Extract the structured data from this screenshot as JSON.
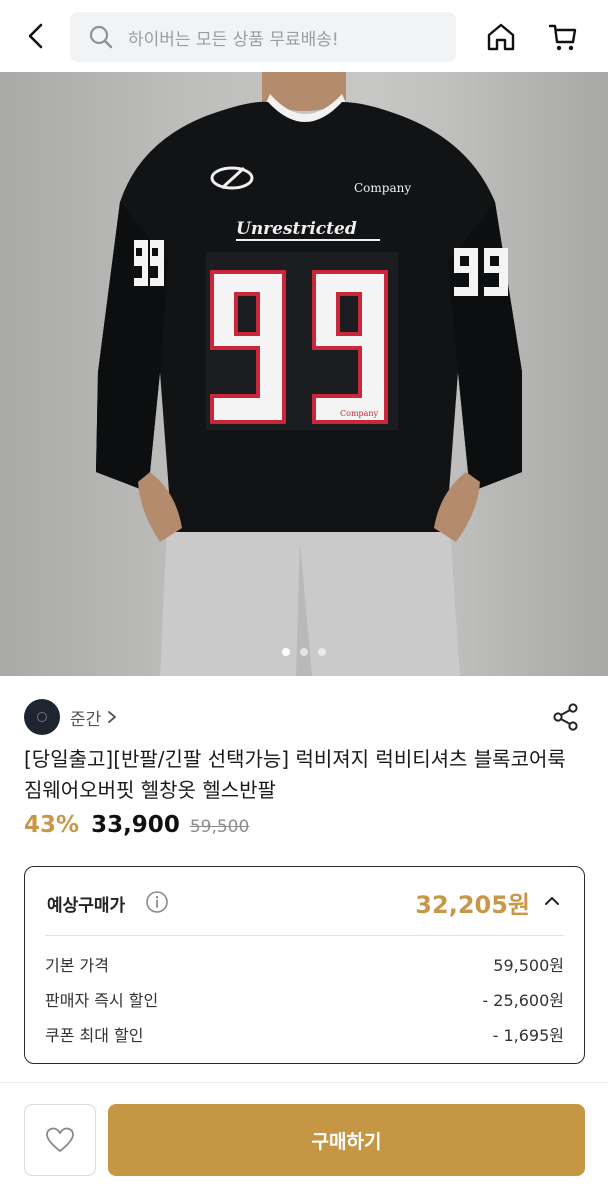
{
  "header": {
    "search_placeholder": "하이버는 모든 상품 무료배송!"
  },
  "hero": {
    "jersey_number": "99",
    "jersey_text": "Unrestricted",
    "jersey_company": "Company",
    "pagination": {
      "total": 3,
      "active": 1
    },
    "colors": {
      "jersey": "#111214",
      "number_fill": "#f4f4f4",
      "number_border": "#c8283a",
      "pants": "#c9c9c9"
    }
  },
  "seller": {
    "name": "준간"
  },
  "product": {
    "title": "[당일출고][반팔/긴팔 선택가능] 럭비져지 럭비티셔츠 블록코어룩 짐웨어오버핏 헬창옷 헬스반팔",
    "discount": "43%",
    "price": "33,900",
    "original_price": "59,500"
  },
  "estimate": {
    "label": "예상구매가",
    "value": "32,205원",
    "rows": [
      {
        "label": "기본 가격",
        "value": "59,500원"
      },
      {
        "label": "판매자 즉시 할인",
        "value": "- 25,600원"
      },
      {
        "label": "쿠폰 최대 할인",
        "value": "- 1,695원"
      }
    ]
  },
  "bottom": {
    "buy_label": "구매하기"
  },
  "theme": {
    "accent": "#c59745",
    "price_accent": "#c8974a"
  }
}
